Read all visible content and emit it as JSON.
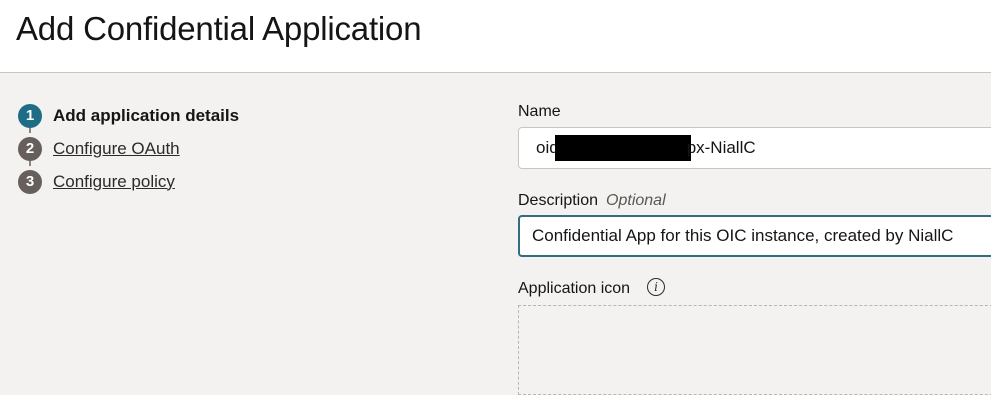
{
  "page": {
    "title": "Add Confidential Application"
  },
  "steps": [
    {
      "number": "1",
      "label": "Add application details",
      "active": true
    },
    {
      "number": "2",
      "label": "Configure OAuth",
      "active": false
    },
    {
      "number": "3",
      "label": "Configure policy",
      "active": false
    }
  ],
  "form": {
    "name": {
      "label": "Name",
      "value_prefix": "oid",
      "value_suffix": "px-NiallC"
    },
    "description": {
      "label": "Description",
      "optional_label": "Optional",
      "value": "Confidential App for this OIC instance, created by NiallC"
    },
    "application_icon": {
      "label": "Application icon",
      "info_icon": "i"
    }
  },
  "colors": {
    "active_step": "#1e6d86",
    "inactive_step": "#665f5b",
    "focus_border": "#356d7f",
    "background": "#f3f2f0"
  }
}
